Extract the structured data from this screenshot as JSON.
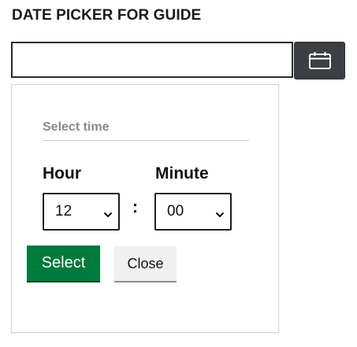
{
  "field": {
    "label": "DATE PICKER FOR GUIDE",
    "value": "",
    "calendar_icon": "calendar-icon"
  },
  "popup": {
    "title": "Select time",
    "hour": {
      "label": "Hour",
      "selected": "12"
    },
    "separator": ":",
    "minute": {
      "label": "Minute",
      "selected": "00"
    },
    "buttons": {
      "select_label": "Select",
      "close_label": "Close"
    }
  },
  "colors": {
    "select_button": "#007a3d",
    "calendar_button": "#3b3f43",
    "close_button": "#f0f0f0"
  }
}
